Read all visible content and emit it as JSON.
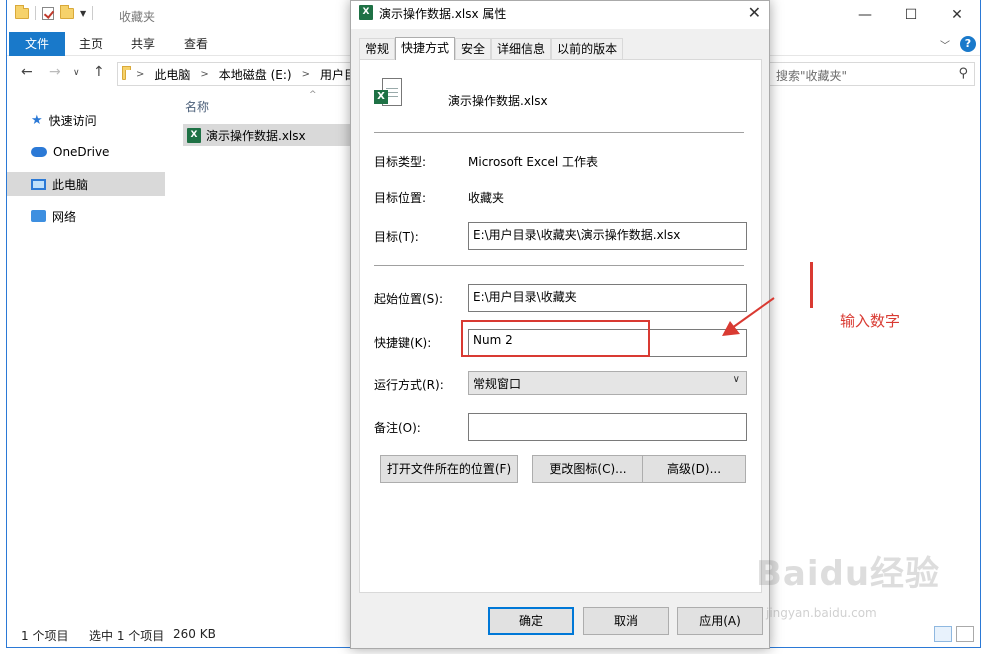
{
  "explorer": {
    "title": "收藏夹",
    "window_controls": {
      "minimize": "—",
      "maximize": "☐",
      "close": "✕"
    },
    "ribbon_tabs": [
      "文件",
      "主页",
      "共享",
      "查看"
    ],
    "ribbon_icons": {
      "collapse": "chevron-down-icon",
      "help": "help-icon"
    },
    "help_symbol": "?",
    "address": {
      "segments": [
        "此电脑",
        "本地磁盘 (E:)",
        "用户目"
      ]
    },
    "search": {
      "placeholder": "搜索\"收藏夹\""
    },
    "nav_pane": [
      {
        "label": "快速访问",
        "icon": "star-icon"
      },
      {
        "label": "OneDrive",
        "icon": "cloud-icon"
      },
      {
        "label": "此电脑",
        "icon": "computer-icon",
        "selected": true
      },
      {
        "label": "网络",
        "icon": "network-icon"
      }
    ],
    "column_header": "名称",
    "files": [
      {
        "name": "演示操作数据.xlsx",
        "icon": "excel-icon",
        "selected": true
      }
    ],
    "status": {
      "item_count": "1 个项目",
      "selection": "选中 1 个项目",
      "size": "260 KB"
    }
  },
  "dialog": {
    "title": "演示操作数据.xlsx 属性",
    "close_symbol": "✕",
    "tabs": [
      "常规",
      "快捷方式",
      "安全",
      "详细信息",
      "以前的版本"
    ],
    "active_tab": "快捷方式",
    "file_name": "演示操作数据.xlsx",
    "target_type_label": "目标类型:",
    "target_type_value": "Microsoft Excel 工作表",
    "target_location_label": "目标位置:",
    "target_location_value": "收藏夹",
    "target_label": "目标(T):",
    "target_value": "E:\\用户目录\\收藏夹\\演示操作数据.xlsx",
    "start_in_label": "起始位置(S):",
    "start_in_value": "E:\\用户目录\\收藏夹",
    "shortcut_key_label": "快捷键(K):",
    "shortcut_key_value": "Num 2",
    "run_label": "运行方式(R):",
    "run_value": "常规窗口",
    "comment_label": "备注(O):",
    "comment_value": "",
    "buttons": {
      "open_location": "打开文件所在的位置(F)",
      "change_icon": "更改图标(C)...",
      "advanced": "高级(D)...",
      "ok": "确定",
      "cancel": "取消",
      "apply": "应用(A)"
    }
  },
  "annotation": {
    "text": "输入数字",
    "color": "#d93a32"
  },
  "watermark": {
    "main": "Baidu经验",
    "sub": "jingyan.baidu.com"
  }
}
